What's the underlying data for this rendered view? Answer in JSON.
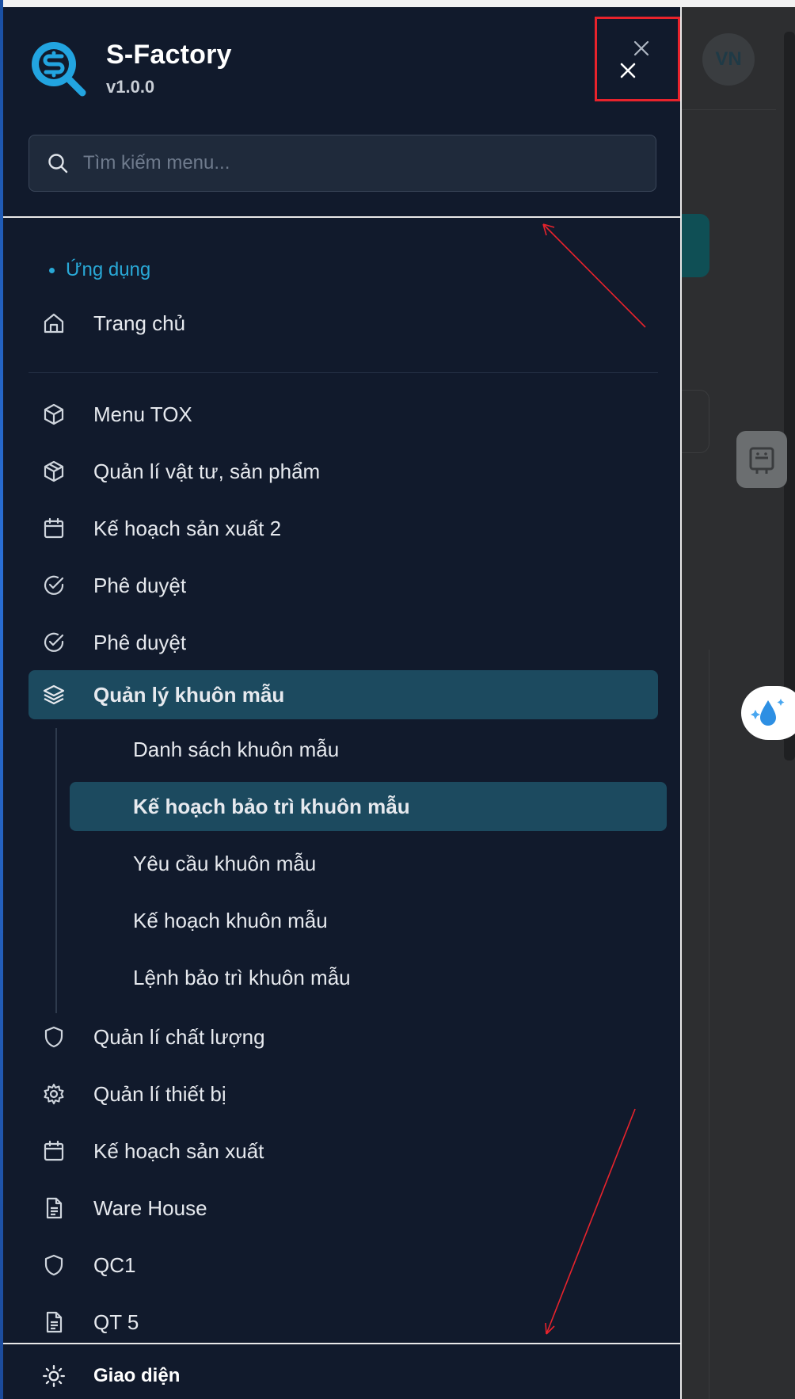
{
  "app": {
    "name": "S-Factory",
    "version": "v1.0.0",
    "logo_icon": "s-factory-logo-icon"
  },
  "header": {
    "avatar_text": "VN"
  },
  "search": {
    "placeholder": "Tìm kiếm menu...",
    "value": ""
  },
  "menu": {
    "section_label": "Ứng dụng",
    "home": {
      "label": "Trang chủ",
      "icon": "home-icon"
    },
    "items": [
      {
        "label": "Menu TOX",
        "icon": "cube-icon"
      },
      {
        "label": "Quản lí vật tư, sản phẩm",
        "icon": "package-icon"
      },
      {
        "label": "Kế hoạch sản xuất 2",
        "icon": "calendar-icon"
      },
      {
        "label": "Phê duyệt",
        "icon": "check-circle-icon"
      },
      {
        "label": "Phê duyệt",
        "icon": "check-circle-icon"
      },
      {
        "label": "Quản lý khuôn mẫu",
        "icon": "layers-icon",
        "active": true
      },
      {
        "label": "Quản lí chất lượng",
        "icon": "shield-icon"
      },
      {
        "label": "Quản lí thiết bị",
        "icon": "gear-icon"
      },
      {
        "label": "Kế hoạch sản xuất",
        "icon": "calendar-icon"
      },
      {
        "label": "Ware House",
        "icon": "document-icon"
      },
      {
        "label": "QC1",
        "icon": "shield-icon"
      },
      {
        "label": "QT 5",
        "icon": "document-icon"
      }
    ],
    "subitems": [
      {
        "label": "Danh sách khuôn mẫu"
      },
      {
        "label": "Kế hoạch bảo trì khuôn mẫu",
        "active": true
      },
      {
        "label": "Yêu cầu khuôn mẫu"
      },
      {
        "label": "Kế hoạch khuôn mẫu"
      },
      {
        "label": "Lệnh bảo trì khuôn mẫu"
      }
    ]
  },
  "footer": {
    "theme_label": "Giao diện",
    "icon": "sun-icon"
  },
  "colors": {
    "drawer_bg": "#111a2c",
    "accent": "#29a8d6",
    "active_bg": "#1c4a5f",
    "annotation_red": "#e8232c"
  }
}
